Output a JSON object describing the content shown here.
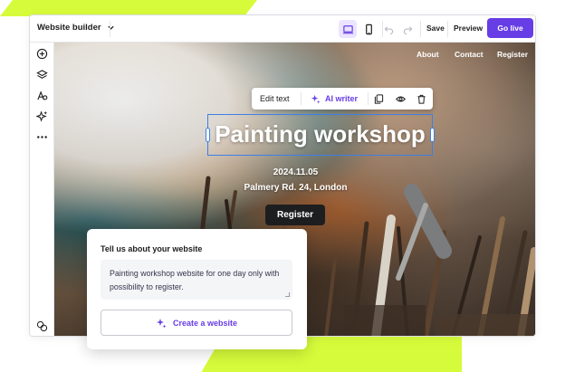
{
  "topbar": {
    "site_selector": "Website builder",
    "save_label": "Save",
    "preview_label": "Preview",
    "go_live_label": "Go live",
    "icons": [
      "chevron-down-icon",
      "desktop-icon",
      "mobile-icon",
      "undo-icon",
      "redo-icon"
    ]
  },
  "sidebar": {
    "items": [
      {
        "icon": "add-icon"
      },
      {
        "icon": "layers-icon"
      },
      {
        "icon": "styles-icon"
      },
      {
        "icon": "ai-tools-icon"
      },
      {
        "icon": "more-icon"
      },
      {
        "icon": "help-icon"
      }
    ]
  },
  "site": {
    "nav": [
      "About",
      "Contact",
      "Register"
    ],
    "headline": "Painting workshop",
    "date": "2024.11.05",
    "address": "Palmery Rd. 24, London",
    "cta_label": "Register"
  },
  "text_toolbar": {
    "edit_label": "Edit text",
    "ai_label": "AI writer",
    "icons": [
      "sparkle-icon",
      "copy-icon",
      "eye-icon",
      "trash-icon"
    ]
  },
  "prompt_card": {
    "title": "Tell us about your website",
    "prompt_value": "Painting workshop website for one day only with possibility to register.",
    "button_label": "Create a website"
  },
  "colors": {
    "accent": "#673de6",
    "accent_light": "#ebe4ff",
    "highlight": "#d6fb3a",
    "selection": "#3d7fe6",
    "dark_button": "#1d1e20"
  }
}
